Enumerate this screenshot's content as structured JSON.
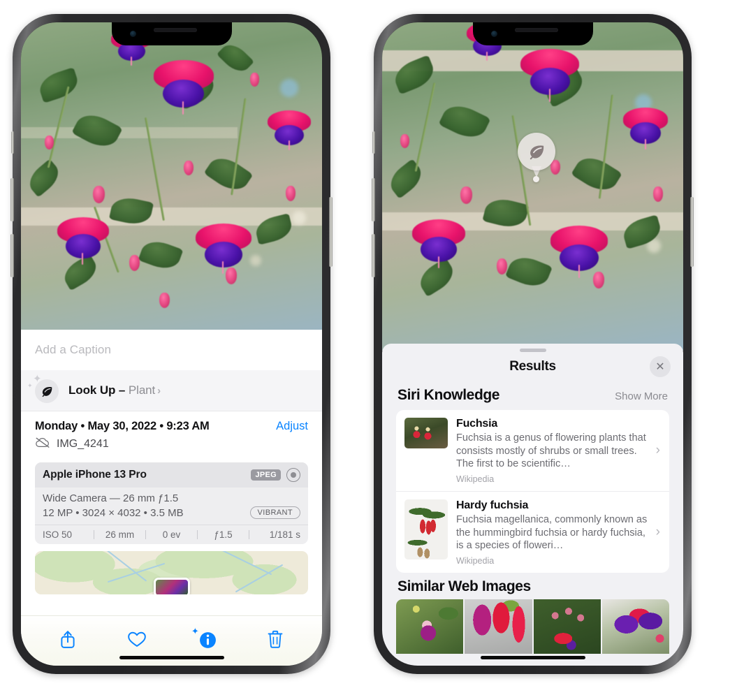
{
  "left_phone": {
    "name": "iphone-photos-detail",
    "photo": {
      "alt": "fuchsia-flowers-photo"
    },
    "caption_field": {
      "placeholder": "Add a Caption",
      "value": ""
    },
    "lookup_row": {
      "icon": "leaf-icon",
      "sparkle_icon": "sparkles-icon",
      "label": "Look Up –",
      "subject": "Plant",
      "chevron": "›"
    },
    "metadata": {
      "date": "Monday • May 30, 2022 • 9:23 AM",
      "adjust_label": "Adjust",
      "cloud_icon": "icloud-slash-icon",
      "filename": "IMG_4241"
    },
    "exif": {
      "device": "Apple iPhone 13 Pro",
      "format_chip": "JPEG",
      "raw_icon": "raw-aperture-icon",
      "lens": "Wide Camera — 26 mm ƒ1.5",
      "size_line": "12 MP • 3024 × 4032 • 3.5 MB",
      "style_chip": "VIBRANT",
      "settings": [
        "ISO 50",
        "26 mm",
        "0 ev",
        "ƒ1.5",
        "1/181 s"
      ]
    },
    "map": {
      "name": "location-map-strip",
      "pin": "photo-thumbnail-pin"
    },
    "toolbar": [
      {
        "name": "share-icon",
        "label": "Share"
      },
      {
        "name": "heart-icon",
        "label": "Favorite"
      },
      {
        "name": "info-icon",
        "label": "Info"
      },
      {
        "name": "trash-icon",
        "label": "Delete"
      }
    ]
  },
  "right_phone": {
    "name": "iphone-visual-lookup-results",
    "badge": {
      "icon": "leaf-icon"
    },
    "sheet": {
      "title": "Results",
      "close_icon": "close-icon",
      "sections": [
        {
          "title": "Siri Knowledge",
          "action": "Show More",
          "items": [
            {
              "title": "Fuchsia",
              "description": "Fuchsia is a genus of flowering plants that consists mostly of shrubs or small trees. The first to be scientific…",
              "source": "Wikipedia",
              "thumb": "fuchsia-flowers-thumb",
              "chevron": "›"
            },
            {
              "title": "Hardy fuchsia",
              "description": "Fuchsia magellanica, commonly known as the hummingbird fuchsia or hardy fuchsia, is a species of floweri…",
              "source": "Wikipedia",
              "thumb": "hardy-fuchsia-specimen-thumb",
              "chevron": "›"
            }
          ]
        },
        {
          "title": "Similar Web Images",
          "images": [
            {
              "name": "web-image-1"
            },
            {
              "name": "web-image-2"
            },
            {
              "name": "web-image-3"
            },
            {
              "name": "web-image-4"
            }
          ]
        }
      ]
    }
  },
  "colors": {
    "accent_blue": "#0a84ff",
    "sheet_bg": "#f1f1f4",
    "card_white": "#ffffff",
    "secondary_text": "#8e8e93"
  }
}
